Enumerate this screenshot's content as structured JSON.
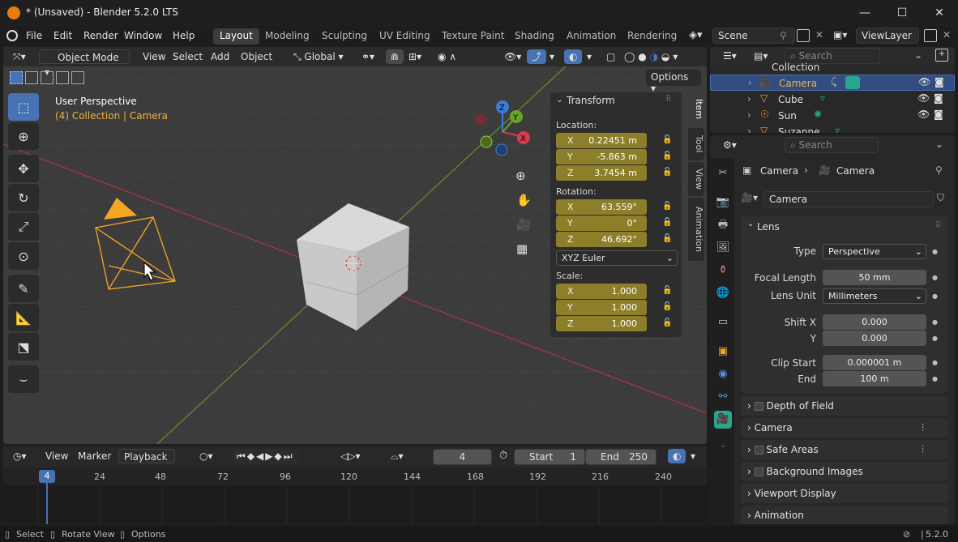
{
  "window": {
    "title": "* (Unsaved) - Blender 5.2.0 LTS",
    "minimize": "—",
    "maximize": "☐",
    "close": "✕"
  },
  "menus": [
    "File",
    "Edit",
    "Render",
    "Window",
    "Help"
  ],
  "workspaces": [
    "Layout",
    "Modeling",
    "Sculpting",
    "UV Editing",
    "Texture Paint",
    "Shading",
    "Animation",
    "Rendering"
  ],
  "scene": {
    "name": "Scene",
    "view_layer": "ViewLayer"
  },
  "viewport": {
    "mode": "Object Mode",
    "menus": [
      "View",
      "Select",
      "Add",
      "Object"
    ],
    "orientation": "Global",
    "options_label": "Options",
    "info_line1": "User Perspective",
    "info_line2": "(4) Collection | Camera",
    "gizmo": {
      "x": "X",
      "y": "Y",
      "z": "Z"
    }
  },
  "npanel": {
    "title": "Transform",
    "location_label": "Location:",
    "location": [
      {
        "axis": "X",
        "value": "0.22451 m"
      },
      {
        "axis": "Y",
        "value": "-5.863 m"
      },
      {
        "axis": "Z",
        "value": "3.7454 m"
      }
    ],
    "rotation_label": "Rotation:",
    "rotation": [
      {
        "axis": "X",
        "value": "63.559°"
      },
      {
        "axis": "Y",
        "value": "0°"
      },
      {
        "axis": "Z",
        "value": "46.692°"
      }
    ],
    "rotation_mode": "XYZ Euler",
    "scale_label": "Scale:",
    "scale": [
      {
        "axis": "X",
        "value": "1.000"
      },
      {
        "axis": "Y",
        "value": "1.000"
      },
      {
        "axis": "Z",
        "value": "1.000"
      }
    ],
    "tabs": [
      "Item",
      "Tool",
      "View",
      "Animation"
    ]
  },
  "outliner": {
    "search_placeholder": "Search",
    "collection": "Collection",
    "items": [
      {
        "name": "Camera",
        "selected": true
      },
      {
        "name": "Cube",
        "selected": false
      },
      {
        "name": "Sun",
        "selected": false
      },
      {
        "name": "Suzanne",
        "selected": false
      }
    ]
  },
  "properties": {
    "search_placeholder": "Search",
    "breadcrumb_object": "Camera",
    "breadcrumb_data": "Camera",
    "datablock": "Camera",
    "lens_section": "Lens",
    "type_label": "Type",
    "type_value": "Perspective",
    "focal_label": "Focal Length",
    "focal_value": "50 mm",
    "lens_unit_label": "Lens Unit",
    "lens_unit_value": "Millimeters",
    "shiftx_label": "Shift X",
    "shiftx_value": "0.000",
    "shifty_label": "Y",
    "shifty_value": "0.000",
    "clipstart_label": "Clip Start",
    "clipstart_value": "0.000001 m",
    "clipend_label": "End",
    "clipend_value": "100 m",
    "sections": [
      "Depth of Field",
      "Camera",
      "Safe Areas",
      "Background Images",
      "Viewport Display",
      "Animation"
    ]
  },
  "timeline": {
    "menus": [
      "View",
      "Marker",
      "Playback"
    ],
    "current_frame": "4",
    "start_label": "Start",
    "start_value": "1",
    "end_label": "End",
    "end_value": "250",
    "ticks": [
      "4",
      "24",
      "48",
      "72",
      "96",
      "120",
      "144",
      "168",
      "192",
      "216",
      "240"
    ]
  },
  "status": {
    "select": "Select",
    "rotate": "Rotate View",
    "options": "Options",
    "version": "5.2.0"
  },
  "colors": {
    "accent": "#4772b3",
    "field_anim": "#8d7f2a",
    "camera_orange": "#f5a623"
  }
}
